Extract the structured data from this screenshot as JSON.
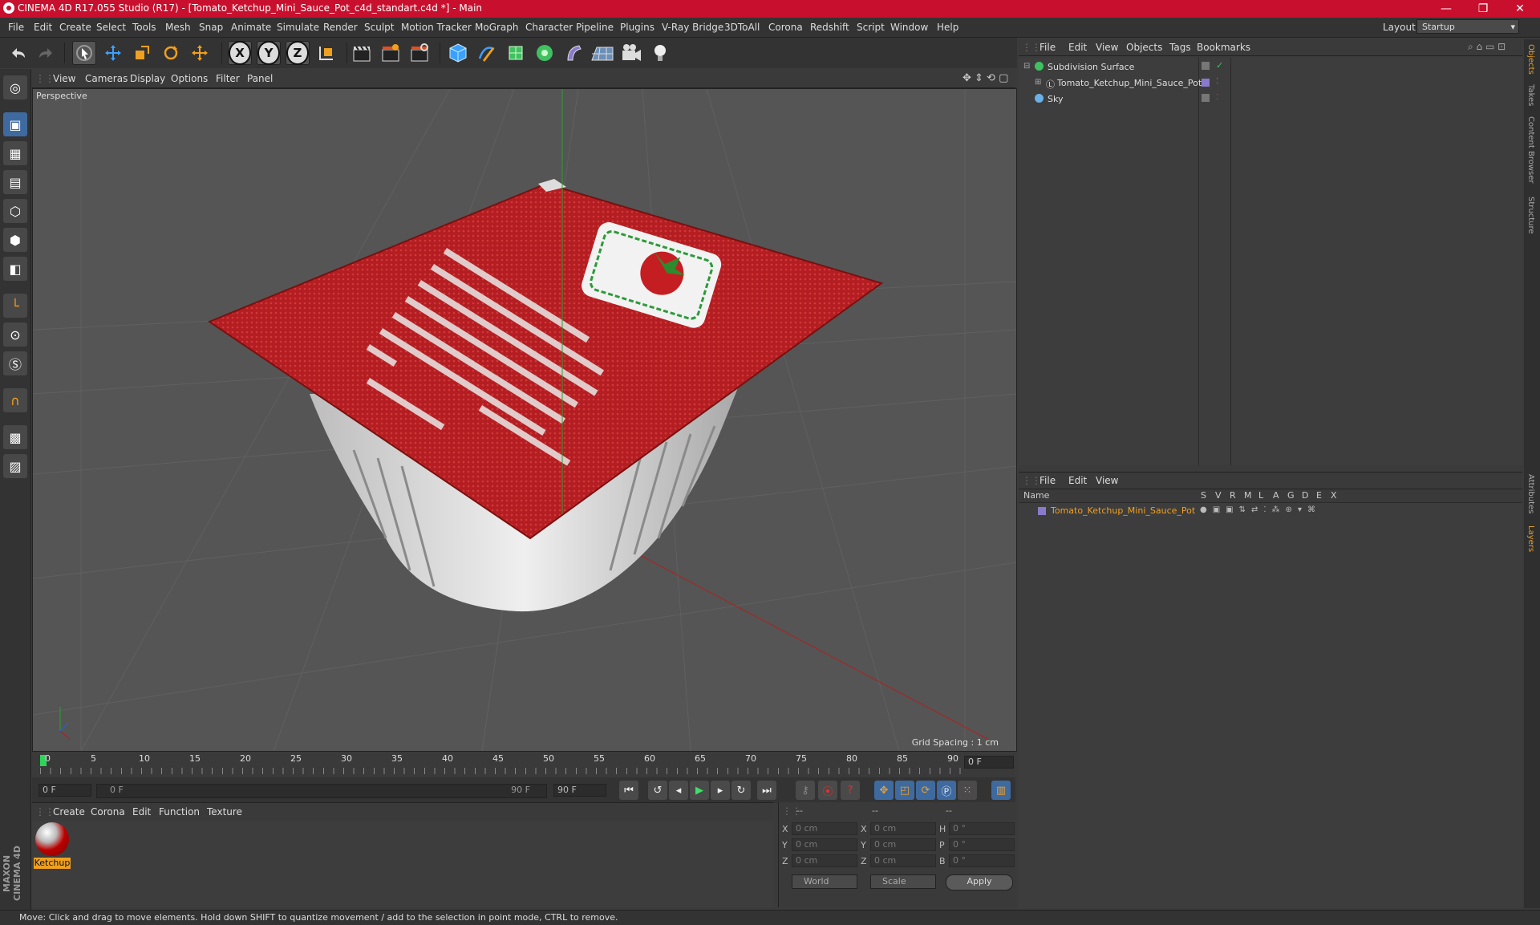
{
  "window": {
    "title": "CINEMA 4D R17.055 Studio (R17) - [Tomato_Ketchup_Mini_Sauce_Pot_c4d_standart.c4d *] - Main",
    "minimize": "—",
    "maximize": "❐",
    "close": "✕"
  },
  "menubar": {
    "items": [
      "File",
      "Edit",
      "Create",
      "Select",
      "Tools",
      "Mesh",
      "Snap",
      "Animate",
      "Simulate",
      "Render",
      "Sculpt",
      "Motion Tracker",
      "MoGraph",
      "Character",
      "Pipeline",
      "Plugins",
      "V-Ray Bridge",
      "3DToAll",
      "Corona",
      "Redshift",
      "Script",
      "Window",
      "Help"
    ],
    "layout_label": "Layout:",
    "layout_value": "Startup"
  },
  "toolbar": {
    "axis_x": "X",
    "axis_y": "Y",
    "axis_z": "Z"
  },
  "viewport": {
    "menu": [
      "View",
      "Cameras",
      "Display",
      "Options",
      "Filter",
      "Panel"
    ],
    "label": "Perspective",
    "grid_spacing": "Grid Spacing : 1 cm"
  },
  "timeline": {
    "ticks": [
      "0",
      "5",
      "10",
      "15",
      "20",
      "25",
      "30",
      "35",
      "40",
      "45",
      "50",
      "55",
      "60",
      "65",
      "70",
      "75",
      "80",
      "85",
      "90"
    ],
    "current_frame": "0 F"
  },
  "transport": {
    "start_field": "0 F",
    "range_start": "0 F",
    "range_end": "90 F",
    "end_field": "90 F"
  },
  "material_manager": {
    "menu": [
      "Create",
      "Corona",
      "Edit",
      "Function",
      "Texture"
    ],
    "material_name": "Ketchup"
  },
  "coordinates": {
    "header": [
      "--",
      "--",
      "--"
    ],
    "rows": [
      {
        "a": "X",
        "v1": "0 cm",
        "b": "X",
        "v2": "0 cm",
        "c": "H",
        "v3": "0 °"
      },
      {
        "a": "Y",
        "v1": "0 cm",
        "b": "Y",
        "v2": "0 cm",
        "c": "P",
        "v3": "0 °"
      },
      {
        "a": "Z",
        "v1": "0 cm",
        "b": "Z",
        "v2": "0 cm",
        "c": "B",
        "v3": "0 °"
      }
    ],
    "mode1": "World",
    "mode2": "Scale",
    "apply": "Apply"
  },
  "object_manager": {
    "menu": [
      "File",
      "Edit",
      "View",
      "Objects",
      "Tags",
      "Bookmarks"
    ],
    "objects": [
      "Subdivision Surface",
      "Tomato_Ketchup_Mini_Sauce_Pot",
      "Sky"
    ]
  },
  "layer_manager": {
    "menu": [
      "File",
      "Edit",
      "View"
    ],
    "columns": [
      "Name",
      "S",
      "V",
      "R",
      "M",
      "L",
      "A",
      "G",
      "D",
      "E",
      "X"
    ],
    "layer_name": "Tomato_Ketchup_Mini_Sauce_Pot"
  },
  "right_tabs": [
    "Objects",
    "Takes",
    "Content Browser",
    "Structure",
    "Attributes",
    "Layers"
  ],
  "brand": "MAXON CINEMA 4D",
  "status": "Move: Click and drag to move elements. Hold down SHIFT to quantize movement / add to the selection in point mode, CTRL to remove.",
  "colors": {
    "titlebar": "#c8102e",
    "accent_orange": "#f0a020",
    "selected_blue": "#3f6aa0"
  }
}
